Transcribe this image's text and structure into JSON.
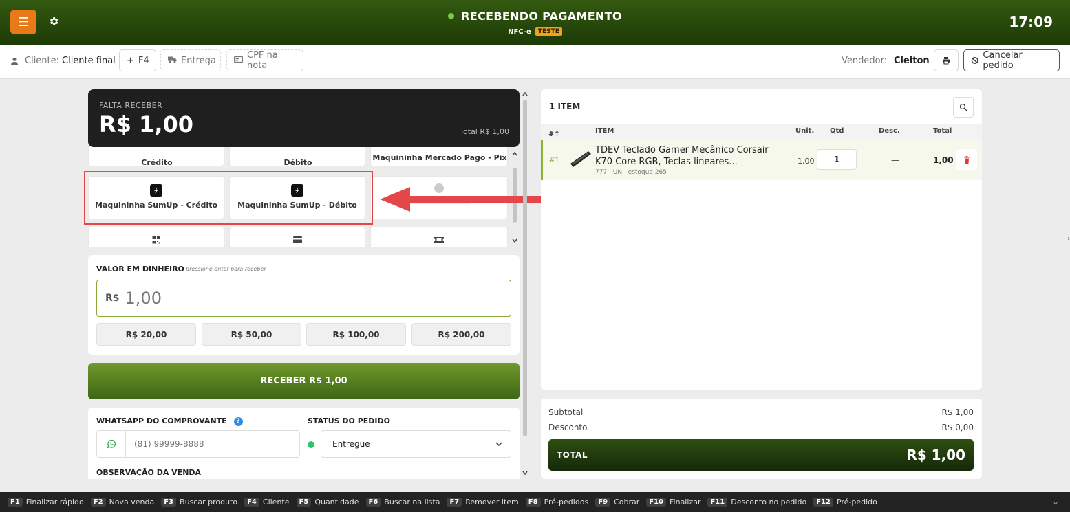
{
  "header": {
    "status_title": "RECEBENDO PAGAMENTO",
    "doc_type": "NFC-e",
    "env_badge": "TESTE",
    "clock": "17:09",
    "accent_color": "#e87a1a"
  },
  "client_bar": {
    "client_label": "Cliente:",
    "client_value": "Cliente final",
    "f4_label": "F4",
    "delivery_label": "Entrega",
    "cpf_label": "CPF na nota",
    "seller_label": "Vendedor:",
    "seller_value": "Cleiton",
    "cancel_label": "Cancelar pedido"
  },
  "payment": {
    "due_label": "FALTA RECEBER",
    "due_value": "R$ 1,00",
    "total_text": "Total R$ 1,00",
    "methods_row1": [
      "Crédito",
      "Débito",
      "Maquininha Mercado Pago - Pix"
    ],
    "methods_row2": [
      "Maquininha SumUp - Crédito",
      "Maquininha SumUp - Débito"
    ]
  },
  "cash": {
    "label": "VALOR EM DINHEIRO",
    "hint": "pressione enter para receber",
    "currency": "R$",
    "amount": "1,00",
    "quick": [
      "R$ 20,00",
      "R$ 50,00",
      "R$ 100,00",
      "R$ 200,00"
    ]
  },
  "receive_button": "RECEBER R$ 1,00",
  "extra": {
    "whatsapp_label": "WHATSAPP DO COMPROVANTE",
    "whatsapp_placeholder": "(81) 99999-8888",
    "status_label": "STATUS DO PEDIDO",
    "status_value": "Entregue",
    "obs_label": "OBSERVAÇÃO DA VENDA"
  },
  "items": {
    "count_label": "1 ITEM",
    "columns": [
      "#",
      "ITEM",
      "Unit.",
      "Qtd",
      "Desc.",
      "Total"
    ],
    "rows": [
      {
        "num": "#1",
        "name": "TDEV Teclado Gamer Mecânico Corsair K70 Core RGB, Teclas lineares...",
        "meta": "777 · UN · estoque 265",
        "unit": "1,00",
        "qty": "1",
        "desc": "—",
        "total": "1,00"
      }
    ]
  },
  "summary": {
    "subtotal_label": "Subtotal",
    "subtotal_value": "R$ 1,00",
    "discount_label": "Desconto",
    "discount_value": "R$ 0,00",
    "total_label": "TOTAL",
    "total_value": "R$ 1,00"
  },
  "footer": [
    {
      "key": "F1",
      "label": "Finalizar rápido"
    },
    {
      "key": "F2",
      "label": "Nova venda"
    },
    {
      "key": "F3",
      "label": "Buscar produto"
    },
    {
      "key": "F4",
      "label": "Cliente"
    },
    {
      "key": "F5",
      "label": "Quantidade"
    },
    {
      "key": "F6",
      "label": "Buscar na lista"
    },
    {
      "key": "F7",
      "label": "Remover item"
    },
    {
      "key": "F8",
      "label": "Pré-pedidos"
    },
    {
      "key": "F9",
      "label": "Cobrar"
    },
    {
      "key": "F10",
      "label": "Finalizar"
    },
    {
      "key": "F11",
      "label": "Desconto no pedido"
    },
    {
      "key": "F12",
      "label": "Pré-pedido"
    }
  ]
}
